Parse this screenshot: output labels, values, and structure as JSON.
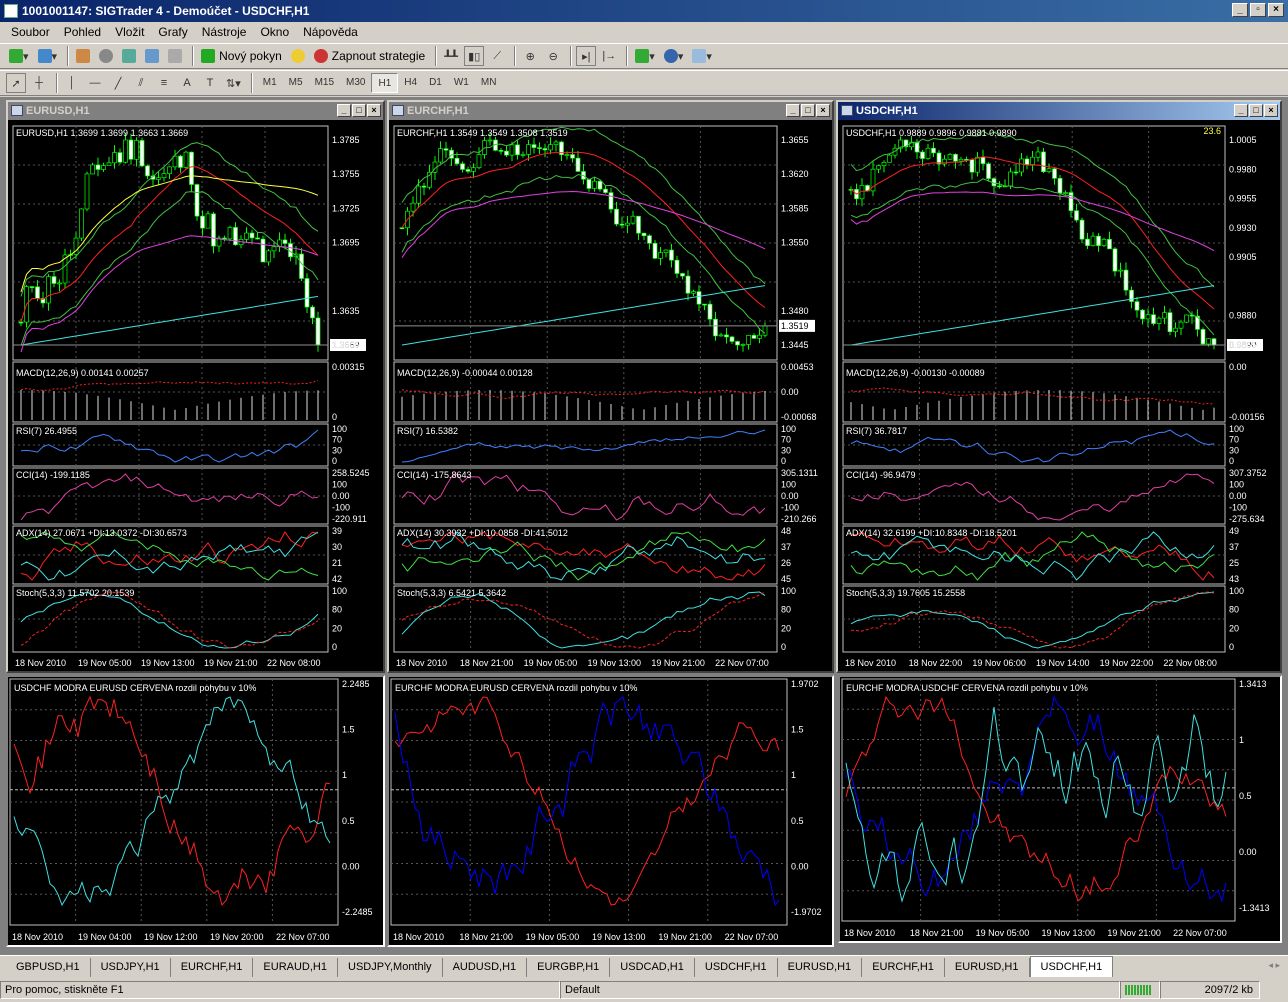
{
  "app": {
    "title": "1001001147: SIGTrader 4 - Demoúčet - USDCHF,H1"
  },
  "menu": [
    "Soubor",
    "Pohled",
    "Vložit",
    "Grafy",
    "Nástroje",
    "Okno",
    "Nápověda"
  ],
  "toolbar": {
    "new_order": "Nový pokyn",
    "strategy": "Zapnout strategie"
  },
  "timeframes": [
    "M1",
    "M5",
    "M15",
    "M30",
    "H1",
    "H4",
    "D1",
    "W1",
    "MN"
  ],
  "timeframe_active": "H1",
  "colors": {
    "up": "#00ff00",
    "grid": "#404040",
    "red": "#ff2020",
    "blue": "#0000ff",
    "cyan": "#40e0e0",
    "magenta": "#e040e0",
    "yellow": "#ffff40"
  },
  "windows": [
    {
      "title": "EURUSD,H1",
      "info": "EURUSD,H1  1.3699 1.3699 1.3663 1.3669",
      "price_ticks": [
        "1.3785",
        "1.3755",
        "1.3725",
        "1.3695",
        "1.3669",
        "1.3635",
        "1.3605"
      ],
      "current": "1.3669",
      "macd": "MACD(12,26,9) 0.00141 0.00257",
      "macd_ticks": [
        "0.00315",
        "0"
      ],
      "rsi": "RSI(7) 26.4955",
      "rsi_ticks": [
        "100",
        "70",
        "30",
        "0"
      ],
      "cci": "CCI(14) -199.1185",
      "cci_ticks": [
        "258.5245",
        "100",
        "0.00",
        "-100",
        "-220.911"
      ],
      "adx": "ADX(14) 27.0671 +DI:13.0372 -DI:30.6573",
      "adx_ticks": [
        "39",
        "30",
        "21",
        "42"
      ],
      "stoch": "Stoch(5,3,3) 11.5702 20.1539",
      "stoch_ticks": [
        "100",
        "80",
        "20",
        "0"
      ],
      "dates": [
        "18 Nov 2010",
        "19 Nov 05:00",
        "19 Nov 13:00",
        "19 Nov 21:00",
        "22 Nov 08:00"
      ]
    },
    {
      "title": "EURCHF,H1",
      "info": "EURCHF,H1  1.3549 1.3549 1.3508 1.3519",
      "price_ticks": [
        "1.3655",
        "1.3620",
        "1.3585",
        "1.3550",
        "1.3519",
        "1.3480",
        "1.3445"
      ],
      "current": "1.3519",
      "macd": "MACD(12,26,9) -0.00044 0.00128",
      "macd_ticks": [
        "0.00453",
        "0.00",
        "-0.00068"
      ],
      "rsi": "RSI(7) 16.5382",
      "rsi_ticks": [
        "100",
        "70",
        "30",
        "0"
      ],
      "cci": "CCI(14) -175.8643",
      "cci_ticks": [
        "305.1311",
        "100",
        "0.00",
        "-100",
        "-210.266"
      ],
      "adx": "ADX(14) 30.3932 +DI:10.0858 -DI:41.5012",
      "adx_ticks": [
        "48",
        "37",
        "26",
        "45"
      ],
      "stoch": "Stoch(5,3,3) 6.5421 5.3642",
      "stoch_ticks": [
        "100",
        "80",
        "20",
        "0"
      ],
      "dates": [
        "18 Nov 2010",
        "18 Nov 21:00",
        "19 Nov 05:00",
        "19 Nov 13:00",
        "19 Nov 21:00",
        "22 Nov 07:00"
      ]
    },
    {
      "title": "USDCHF,H1",
      "info": "USDCHF,H1  0.9889 0.9896 0.9881 0.9890",
      "price_ticks": [
        "1.0005",
        "0.9980",
        "0.9955",
        "0.9930",
        "0.9905",
        "0.9890",
        "0.9880",
        "0.9855"
      ],
      "current": "0.9890",
      "spread": "23.6",
      "macd": "MACD(12,26,9) -0.00130 -0.00089",
      "macd_ticks": [
        "0.00",
        "-0.00156"
      ],
      "rsi": "RSI(7) 36.7817",
      "rsi_ticks": [
        "100",
        "70",
        "30",
        "0"
      ],
      "cci": "CCI(14) -96.9479",
      "cci_ticks": [
        "307.3752",
        "100",
        "0.00",
        "-100",
        "-275.634"
      ],
      "adx": "ADX(14) 32.6199 +DI:10.8348 -DI:18.5201",
      "adx_ticks": [
        "49",
        "37",
        "25",
        "43"
      ],
      "stoch": "Stoch(5,3,3) 19.7605 15.2558",
      "stoch_ticks": [
        "100",
        "80",
        "20",
        "0"
      ],
      "dates": [
        "18 Nov 2010",
        "18 Nov 22:00",
        "19 Nov 06:00",
        "19 Nov 14:00",
        "19 Nov 22:00",
        "22 Nov 08:00"
      ]
    }
  ],
  "correlations": [
    {
      "label": "USDCHF MODRA   EURUSD CERVENA    rozdil pohybu v 10%",
      "ticks": [
        "2.2485",
        "1.5",
        "1",
        "0.5",
        "0.00",
        "-2.2485"
      ],
      "dates": [
        "18 Nov 2010",
        "19 Nov 04:00",
        "19 Nov 12:00",
        "19 Nov 20:00",
        "22 Nov 07:00"
      ]
    },
    {
      "label": "EURCHF MODRA   EURUSD CERVENA      rozdil pohybu v 10%",
      "ticks": [
        "1.9702",
        "1.5",
        "1",
        "0.5",
        "0.00",
        "-1.9702"
      ],
      "dates": [
        "18 Nov 2010",
        "18 Nov 21:00",
        "19 Nov 05:00",
        "19 Nov 13:00",
        "19 Nov 21:00",
        "22 Nov 07:00"
      ]
    },
    {
      "label": "EURCHF MODRA   USDCHF CERVENA      rozdil pohybu v 10%",
      "ticks": [
        "1.3413",
        "1",
        "0.5",
        "0.00",
        "-1.3413"
      ],
      "dates": [
        "18 Nov 2010",
        "18 Nov 21:00",
        "19 Nov 05:00",
        "19 Nov 13:00",
        "19 Nov 21:00",
        "22 Nov 07:00"
      ]
    }
  ],
  "tabs": [
    "GBPUSD,H1",
    "USDJPY,H1",
    "EURCHF,H1",
    "EURAUD,H1",
    "USDJPY,Monthly",
    "AUDUSD,H1",
    "EURGBP,H1",
    "USDCAD,H1",
    "USDCHF,H1",
    "EURUSD,H1",
    "EURCHF,H1",
    "EURUSD,H1",
    "USDCHF,H1"
  ],
  "tab_active": 12,
  "status": {
    "help": "Pro pomoc, stiskněte F1",
    "profile": "Default",
    "traffic": "2097/2 kb"
  }
}
